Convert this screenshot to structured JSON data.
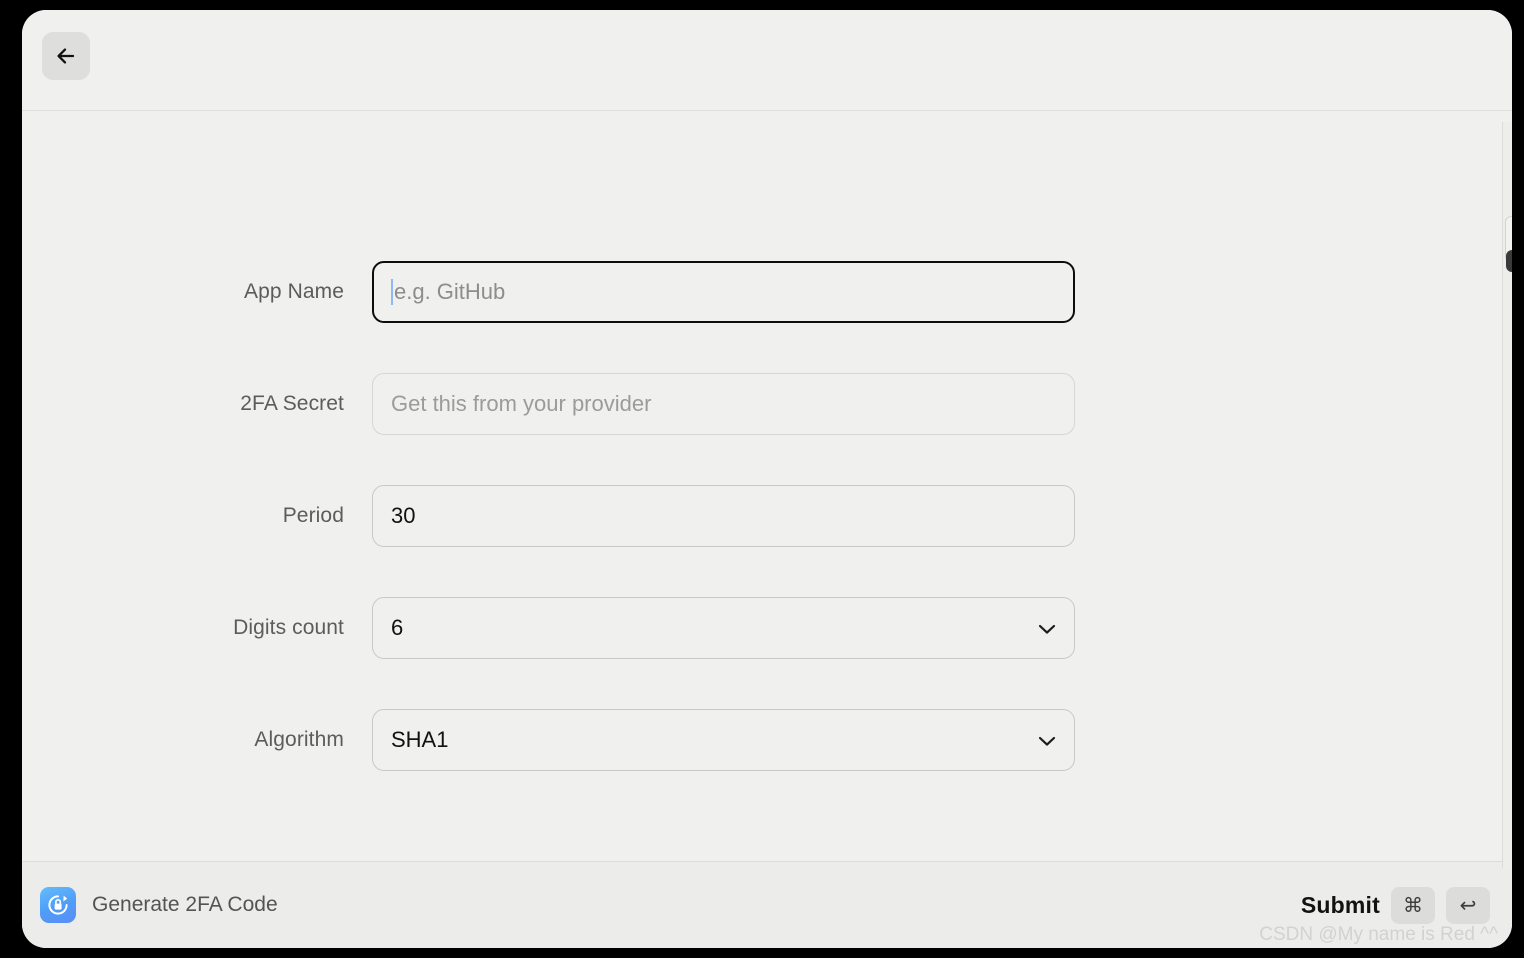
{
  "window": {
    "back_button_icon": "arrow-left-icon"
  },
  "form": {
    "fields": [
      {
        "label": "App Name",
        "value": "",
        "placeholder": "e.g. GitHub",
        "type": "text",
        "focused": true
      },
      {
        "label": "2FA Secret",
        "value": "",
        "placeholder": "Get this from your provider",
        "type": "text",
        "focused": false
      },
      {
        "label": "Period",
        "value": "30",
        "placeholder": "",
        "type": "text",
        "focused": false
      },
      {
        "label": "Digits count",
        "value": "6",
        "placeholder": "",
        "type": "select",
        "focused": false
      },
      {
        "label": "Algorithm",
        "value": "SHA1",
        "placeholder": "",
        "type": "select",
        "focused": false
      }
    ]
  },
  "footer": {
    "app_icon": "lock-refresh-icon",
    "app_title": "Generate 2FA Code",
    "submit_label": "Submit",
    "keys": [
      {
        "glyph": "⌘",
        "name": "command-key"
      },
      {
        "glyph": "↩",
        "name": "return-key"
      }
    ]
  },
  "watermark": {
    "text": "CSDN @My name is Red ^^"
  },
  "colors": {
    "window_background": "#f0f0ef",
    "footer_background": "#ececeb",
    "field_border": "#c9c9c8",
    "field_border_focused": "#0d0d0d",
    "label_text": "#5c5c5c",
    "value_text": "#111111",
    "placeholder_text": "#8d8d8d",
    "caret": "#8fb9f5",
    "accent_icon": "#4f9cf8"
  }
}
